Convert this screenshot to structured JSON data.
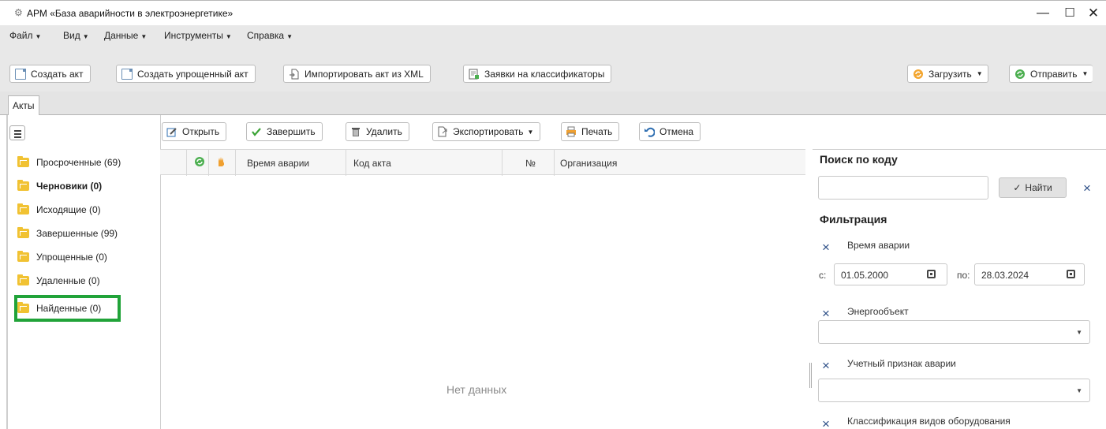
{
  "window": {
    "title": "АРМ «База аварийности в электроэнергетике»",
    "app_icon": "app-logo-icon",
    "minimize": "—",
    "maximize": "☐",
    "close": "✕"
  },
  "menu": [
    {
      "label": "Файл"
    },
    {
      "label": "Вид"
    },
    {
      "label": "Данные"
    },
    {
      "label": "Инструменты"
    },
    {
      "label": "Справка"
    }
  ],
  "toolbar": {
    "create_act": "Создать акт",
    "create_simple_act": "Создать упрощенный акт",
    "import_xml": "Импортировать акт из XML",
    "classifier_requests": "Заявки на классификаторы",
    "load": "Загрузить",
    "send": "Отправить"
  },
  "tabs": [
    {
      "label": "Акты"
    }
  ],
  "folders": [
    {
      "label": "Просроченные (69)"
    },
    {
      "label": "Черновики (0)"
    },
    {
      "label": "Исходящие (0)"
    },
    {
      "label": "Завершенные (99)"
    },
    {
      "label": "Упрощенные (0)"
    },
    {
      "label": "Удаленные (0)"
    },
    {
      "label": "Найденные (0)"
    }
  ],
  "actions": {
    "open": "Открыть",
    "finish": "Завершить",
    "delete": "Удалить",
    "export": "Экспортировать",
    "print": "Печать",
    "cancel": "Отмена"
  },
  "grid": {
    "columns": [
      "Время аварии",
      "Код акта",
      "№",
      "Организация"
    ],
    "empty_text": "Нет данных"
  },
  "search": {
    "title": "Поиск по коду",
    "value": "",
    "find_label": "Найти",
    "clear": "×"
  },
  "filter": {
    "title": "Фильтрация",
    "accident_time_label": "Время аварии",
    "from_label": "с:",
    "from_value": "01.05.2000",
    "to_label": "по:",
    "to_value": "28.03.2024",
    "energy_object_label": "Энергообъект",
    "energy_object_value": "",
    "accounting_sign_label": "Учетный признак аварии",
    "accounting_sign_value": "",
    "equipment_classification_label": "Классификация видов оборудования"
  },
  "colors": {
    "folder_yellow": "#f1c232",
    "highlight_green": "#21a339",
    "clear_x_blue": "#2d4f87",
    "menubar_bg": "#e8e8e8"
  }
}
